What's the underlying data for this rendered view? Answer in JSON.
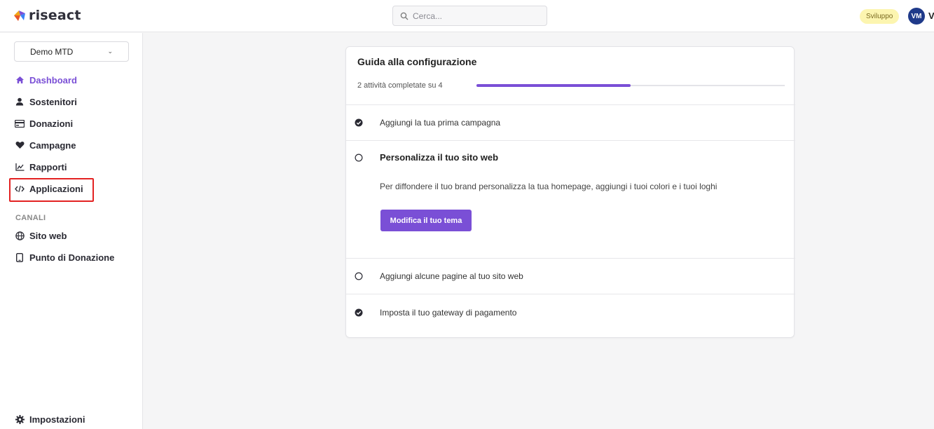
{
  "app": {
    "name": "riseact"
  },
  "colors": {
    "accent": "#7a4fd6",
    "highlight": "#e32222",
    "avatar": "#1f3a8a",
    "badge": "#fcf5b0"
  },
  "header": {
    "search": {
      "placeholder": "Cerca..."
    },
    "env_badge": "Sviluppo",
    "avatar_initials": "VM",
    "user_name_visible": "V"
  },
  "sidebar": {
    "store_select": "Demo MTD",
    "items": [
      {
        "label": "Dashboard",
        "icon": "home-icon",
        "active": true
      },
      {
        "label": "Sostenitori",
        "icon": "user-icon"
      },
      {
        "label": "Donazioni",
        "icon": "credit-card-icon"
      },
      {
        "label": "Campagne",
        "icon": "heart-icon"
      },
      {
        "label": "Rapporti",
        "icon": "chart-icon"
      },
      {
        "label": "Applicazioni",
        "icon": "code-icon",
        "highlighted": true
      }
    ],
    "section_channels": "CANALI",
    "channels": [
      {
        "label": "Sito web",
        "icon": "globe-icon"
      },
      {
        "label": "Punto di Donazione",
        "icon": "mobile-icon"
      }
    ],
    "settings": {
      "label": "Impostazioni",
      "icon": "gear-icon"
    }
  },
  "guide": {
    "title": "Guida alla configurazione",
    "progress_text": "2 attività completate su 4",
    "progress_completed": 2,
    "progress_total": 4,
    "tasks": [
      {
        "label": "Aggiungi la tua prima campagna",
        "done": true
      },
      {
        "label": "Personalizza il tuo sito web",
        "done": false,
        "expanded": true,
        "description": "Per diffondere il tuo brand personalizza la tua homepage, aggiungi i tuoi colori e i tuoi loghi",
        "button": "Modifica il tuo tema"
      },
      {
        "label": "Aggiungi alcune pagine al tuo sito web",
        "done": false
      },
      {
        "label": "Imposta il tuo gateway di pagamento",
        "done": true
      }
    ]
  }
}
